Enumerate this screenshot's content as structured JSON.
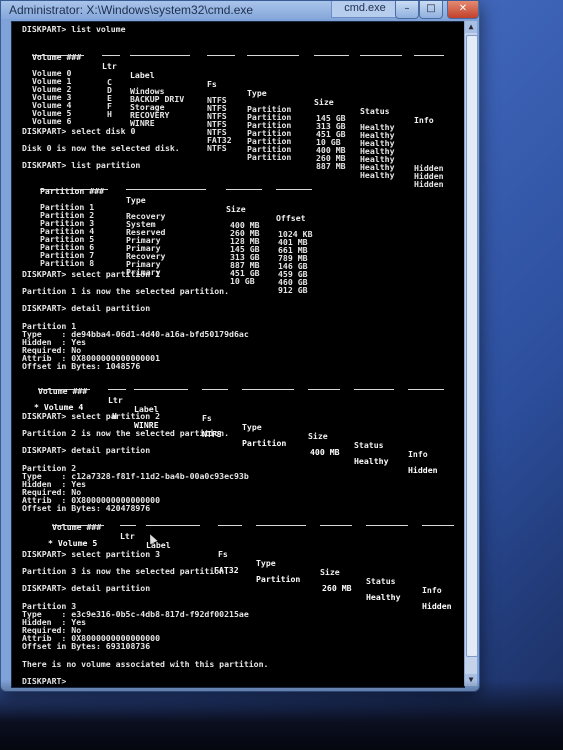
{
  "window": {
    "title": "Administrator: X:\\Windows\\system32\\cmd.exe",
    "tab": "cmd.exe",
    "minimize": "–",
    "maximize": "□",
    "close": "✕"
  },
  "console": {
    "prompt_list_volume": "DISKPART> list volume",
    "volume_table": {
      "headers": [
        "Volume ###",
        "Ltr",
        "Label",
        "Fs",
        "Type",
        "Size",
        "Status",
        "Info"
      ],
      "rows": [
        [
          "Volume 0",
          "C",
          "Windows",
          "NTFS",
          "Partition",
          "145 GB",
          "Healthy",
          ""
        ],
        [
          "Volume 1",
          "D",
          "BACKUP DRIV",
          "NTFS",
          "Partition",
          "313 GB",
          "Healthy",
          ""
        ],
        [
          "Volume 2",
          "E",
          "Storage",
          "NTFS",
          "Partition",
          "451 GB",
          "Healthy",
          ""
        ],
        [
          "Volume 3",
          "F",
          "RECOVERY",
          "NTFS",
          "Partition",
          "10 GB",
          "Healthy",
          ""
        ],
        [
          "Volume 4",
          "H",
          "WINRE",
          "NTFS",
          "Partition",
          "400 MB",
          "Healthy",
          "Hidden"
        ],
        [
          "Volume 5",
          "",
          "",
          "FAT32",
          "Partition",
          "260 MB",
          "Healthy",
          "Hidden"
        ],
        [
          "Volume 6",
          "",
          "",
          "NTFS",
          "Partition",
          "887 MB",
          "Healthy",
          "Hidden"
        ]
      ]
    },
    "prompt_select_disk": "DISKPART> select disk 0",
    "msg_disk_selected": "Disk 0 is now the selected disk.",
    "prompt_list_partition": "DISKPART> list partition",
    "partition_table": {
      "headers": [
        "Partition ###",
        "Type",
        "Size",
        "Offset"
      ],
      "rows": [
        [
          "Partition 1",
          "Recovery",
          "400 MB",
          "1024 KB"
        ],
        [
          "Partition 2",
          "System",
          "260 MB",
          "401 MB"
        ],
        [
          "Partition 3",
          "Reserved",
          "128 MB",
          "661 MB"
        ],
        [
          "Partition 4",
          "Primary",
          "145 GB",
          "789 MB"
        ],
        [
          "Partition 5",
          "Primary",
          "313 GB",
          "146 GB"
        ],
        [
          "Partition 6",
          "Recovery",
          "887 MB",
          "459 GB"
        ],
        [
          "Partition 7",
          "Primary",
          "451 GB",
          "460 GB"
        ],
        [
          "Partition 8",
          "Primary",
          "10 GB",
          "912 GB"
        ]
      ]
    },
    "prompt_select_p1": "DISKPART> select partition 1",
    "msg_p1_selected": "Partition 1 is now the selected partition.",
    "prompt_detail_p1": "DISKPART> detail partition",
    "detail_p1": [
      "Partition 1",
      "Type    : de94bba4-06d1-4d40-a16a-bfd50179d6ac",
      "Hidden  : Yes",
      "Required: No",
      "Attrib  : 0X8000000000000001",
      "Offset in Bytes: 1048576"
    ],
    "vol_headers": [
      "Volume ###",
      "Ltr",
      "Label",
      "Fs",
      "Type",
      "Size",
      "Status",
      "Info"
    ],
    "vol_row_p1": [
      "* Volume 4",
      "H",
      "WINRE",
      "NTFS",
      "Partition",
      "400 MB",
      "Healthy",
      "Hidden"
    ],
    "prompt_select_p2": "DISKPART> select partition 2",
    "msg_p2_selected": "Partition 2 is now the selected partition.",
    "prompt_detail_p2": "DISKPART> detail partition",
    "detail_p2": [
      "Partition 2",
      "Type    : c12a7328-f81f-11d2-ba4b-00a0c93ec93b",
      "Hidden  : Yes",
      "Required: No",
      "Attrib  : 0X8000000000000000",
      "Offset in Bytes: 420478976"
    ],
    "vol_row_p2": [
      "* Volume 5",
      "",
      "",
      "FAT32",
      "Partition",
      "260 MB",
      "Healthy",
      "Hidden"
    ],
    "prompt_select_p3": "DISKPART> select partition 3",
    "msg_p3_selected": "Partition 3 is now the selected partition.",
    "prompt_detail_p3": "DISKPART> detail partition",
    "detail_p3": [
      "Partition 3",
      "Type    : e3c9e316-0b5c-4db8-817d-f92df00215ae",
      "Hidden  : Yes",
      "Required: No",
      "Attrib  : 0X8000000000000000",
      "Offset in Bytes: 693108736"
    ],
    "msg_no_volume": "There is no volume associated with this partition.",
    "final_prompt": "DISKPART>"
  }
}
